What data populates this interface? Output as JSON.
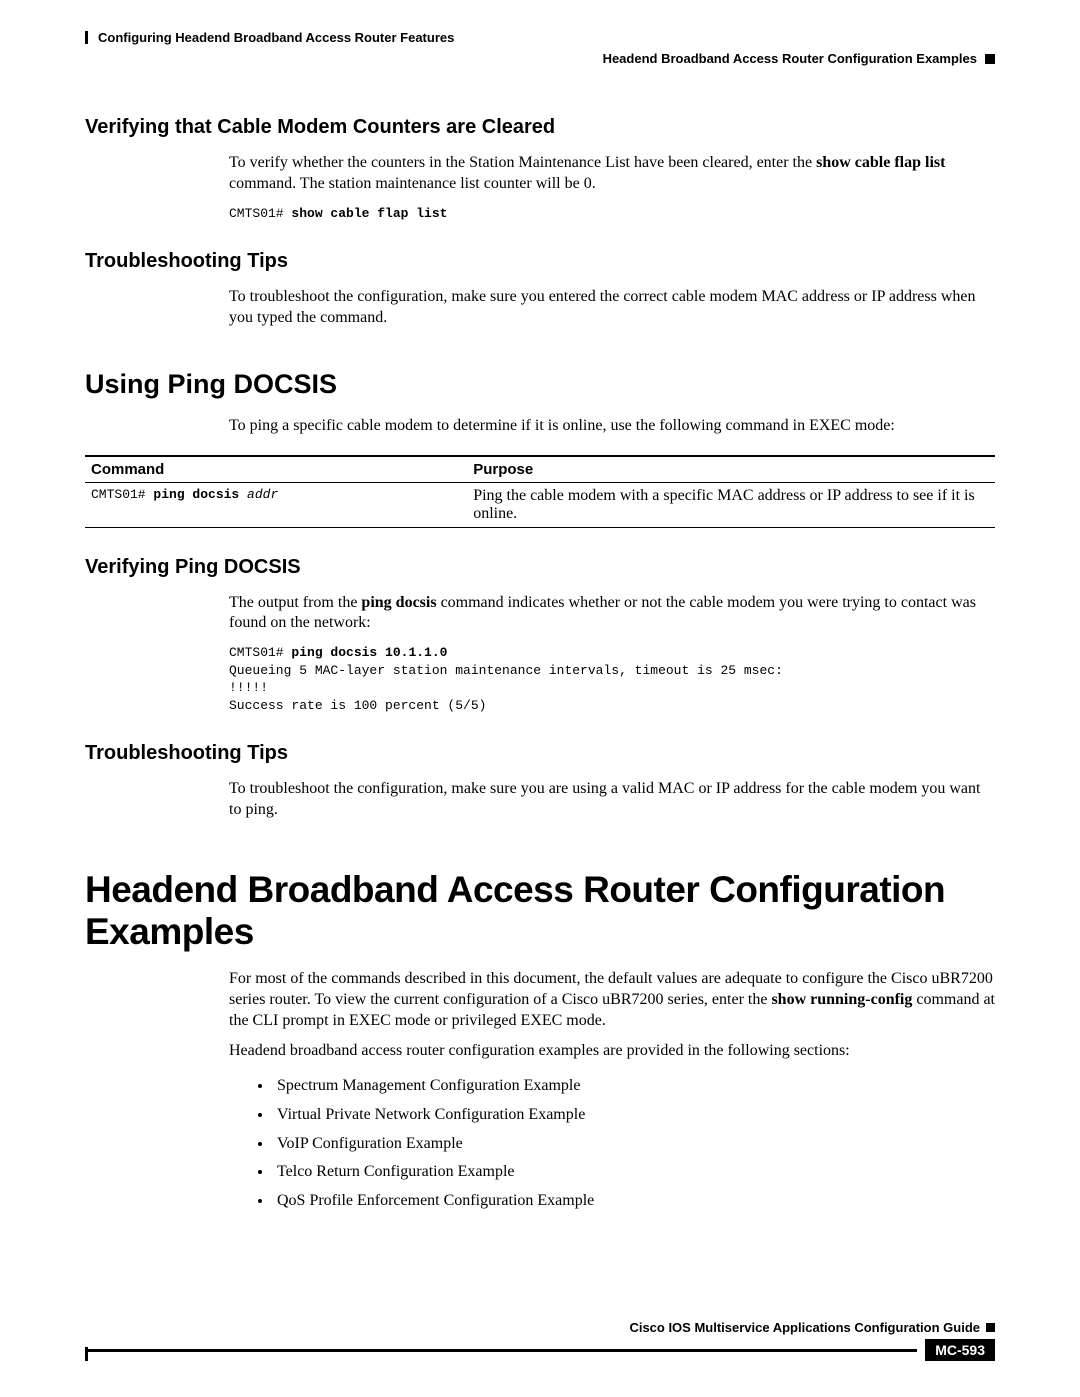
{
  "header": {
    "chapter": "Configuring Headend Broadband Access Router Features",
    "section": "Headend Broadband Access Router Configuration Examples"
  },
  "s1": {
    "heading": "Verifying that Cable Modem Counters are Cleared",
    "para_pre": "To verify whether the counters in the Station Maintenance List have been cleared, enter the ",
    "para_bold": "show cable flap list",
    "para_post": " command. The station maintenance list counter will be 0.",
    "code_prompt": "CMTS01# ",
    "code_cmd": "show cable flap list"
  },
  "s2": {
    "heading": "Troubleshooting Tips",
    "para": "To troubleshoot the configuration, make sure you entered the correct cable modem MAC address or IP address when you typed the command."
  },
  "s3": {
    "heading": "Using Ping DOCSIS",
    "para": "To ping a specific cable modem to determine if it is online, use the following command in EXEC mode:"
  },
  "table": {
    "h1": "Command",
    "h2": "Purpose",
    "cmd_prompt": "CMTS01# ",
    "cmd_bold": "ping docsis",
    "cmd_italic": " addr",
    "purpose": "Ping the cable modem with a specific MAC address or IP address to see if it is online."
  },
  "s4": {
    "heading": "Verifying Ping DOCSIS",
    "para_pre": "The output from the ",
    "para_bold": "ping docsis",
    "para_post": " command indicates whether or not the cable modem you were trying to contact was found on the network:",
    "code_prompt": "CMTS01# ",
    "code_cmd": "ping docsis 10.1.1.0",
    "code_rest": "Queueing 5 MAC-layer station maintenance intervals, timeout is 25 msec:\n!!!!!\nSuccess rate is 100 percent (5/5)"
  },
  "s5": {
    "heading": "Troubleshooting Tips",
    "para": "To troubleshoot the configuration, make sure you are using a valid MAC or IP address for the cable modem you want to ping."
  },
  "s6": {
    "heading": "Headend Broadband Access Router Configuration Examples",
    "para1_pre": "For most of the commands described in this document, the default values are adequate to configure the Cisco uBR7200 series router. To view the current configuration of a Cisco uBR7200 series, enter the ",
    "para1_bold": "show running-config",
    "para1_post": " command at the CLI prompt in EXEC mode or privileged EXEC mode.",
    "para2": "Headend broadband access router configuration examples are provided in the following sections:",
    "items": [
      "Spectrum Management Configuration Example",
      "Virtual Private Network Configuration Example",
      "VoIP Configuration Example",
      "Telco Return Configuration Example",
      "QoS Profile Enforcement Configuration Example"
    ]
  },
  "footer": {
    "guide": "Cisco IOS Multiservice Applications Configuration Guide",
    "page": "MC-593"
  }
}
